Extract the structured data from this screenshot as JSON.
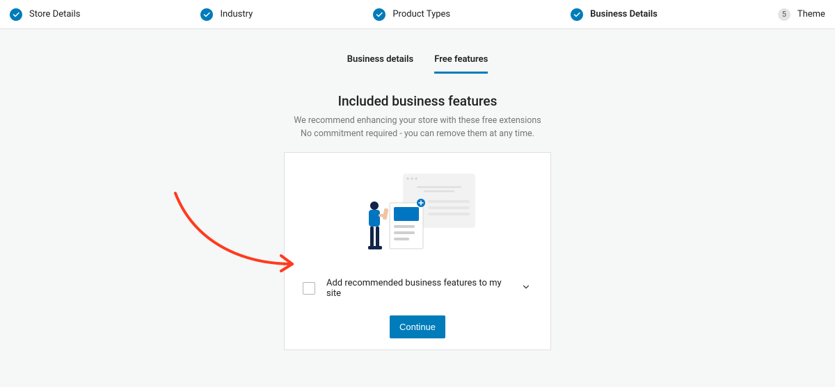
{
  "stepper": {
    "steps": [
      {
        "label": "Store Details",
        "done": true
      },
      {
        "label": "Industry",
        "done": true
      },
      {
        "label": "Product Types",
        "done": true
      },
      {
        "label": "Business Details",
        "done": true,
        "active": true
      },
      {
        "label": "Theme",
        "done": false,
        "number": "5"
      }
    ]
  },
  "tabs": {
    "business_details": "Business details",
    "free_features": "Free features"
  },
  "intro": {
    "title": "Included business features",
    "line1": "We recommend enhancing your store with these free extensions",
    "line2": "No commitment required - you can remove them at any time."
  },
  "checkbox": {
    "label": "Add recommended business features to my site"
  },
  "actions": {
    "continue": "Continue"
  },
  "colors": {
    "primary": "#007cba",
    "arrow": "#ff3b1f"
  }
}
